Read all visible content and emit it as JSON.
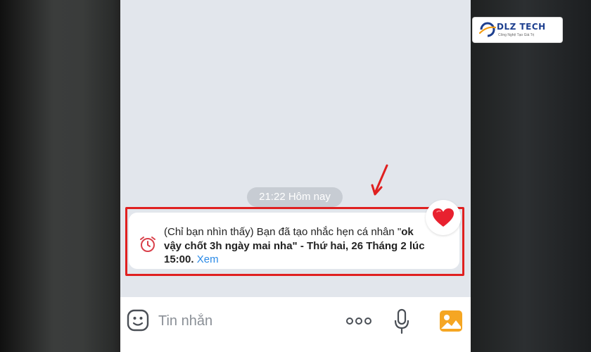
{
  "chat": {
    "timestamp": "21:22 Hôm nay",
    "reminder_notice": {
      "line1_prefix": "(Chỉ bạn nhìn thấy) Bạn đã tạo nhắc hẹn cá nhân \"",
      "line1_quote": "ok",
      "line2_quote": "vậy chốt 3h ngày mai nha\" - Thứ hai, 26 Tháng 2 lúc",
      "line3_time": "15:00.",
      "view_link": "Xem"
    },
    "reaction": "heart"
  },
  "input_bar": {
    "placeholder": "Tin nhắn",
    "icons": [
      "sticker-icon",
      "more-icon",
      "microphone-icon",
      "gallery-icon"
    ]
  },
  "watermark": {
    "brand": "DLZ TECH",
    "tagline": "Công Nghệ Tạo Giá Trị"
  },
  "annotation": {
    "highlight_color": "#e02020"
  }
}
